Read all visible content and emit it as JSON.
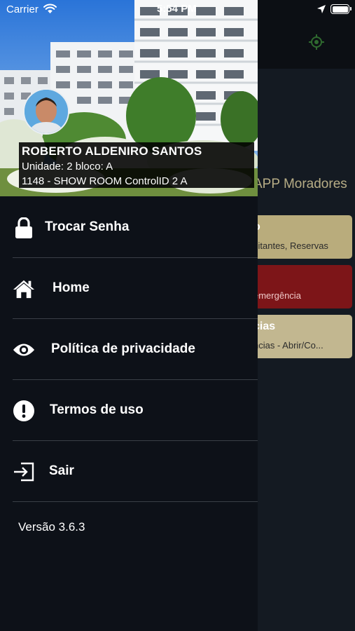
{
  "status_bar": {
    "carrier": "Carrier",
    "time": "5:54 PM"
  },
  "background_app": {
    "title": "APP Moradores",
    "cards": [
      {
        "title": "o",
        "subtitle": "sitantes, Reservas"
      },
      {
        "title": "",
        "subtitle": "emergência"
      },
      {
        "title": "cias",
        "subtitle": "ncias - Abrir/Co..."
      }
    ],
    "colors": {
      "accent": "#b9ac7c",
      "danger": "#7d1518",
      "locate_icon": "#2f6a2f"
    }
  },
  "drawer": {
    "user": {
      "name": "ROBERTO ALDENIRO SANTOS",
      "unit": "Unidade: 2 bloco: A",
      "condo": "1148 - SHOW ROOM ControlID 2 A"
    },
    "menu": [
      {
        "label": "Trocar Senha",
        "icon": "lock-icon"
      },
      {
        "label": "Home",
        "icon": "home-icon"
      },
      {
        "label": "Política de privacidade",
        "icon": "eye-icon"
      },
      {
        "label": "Termos de uso",
        "icon": "exclamation-icon"
      },
      {
        "label": "Sair",
        "icon": "logout-icon"
      }
    ],
    "version": "Versão 3.6.3"
  }
}
